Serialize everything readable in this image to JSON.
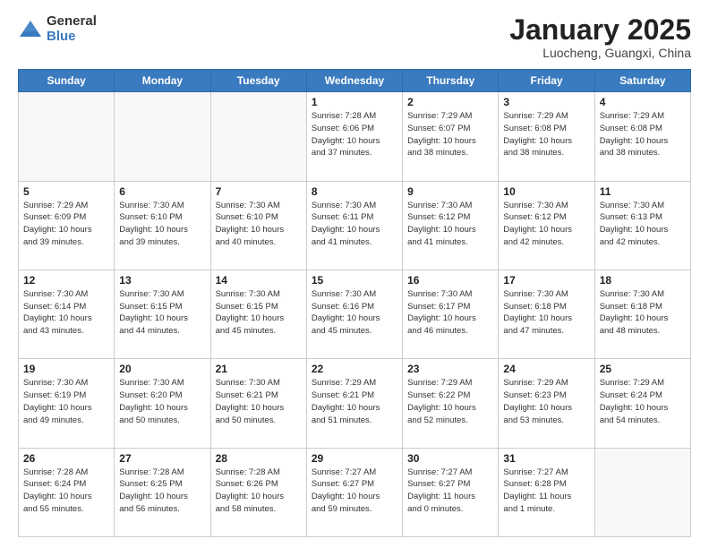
{
  "header": {
    "logo_general": "General",
    "logo_blue": "Blue",
    "month_title": "January 2025",
    "location": "Luocheng, Guangxi, China"
  },
  "days_of_week": [
    "Sunday",
    "Monday",
    "Tuesday",
    "Wednesday",
    "Thursday",
    "Friday",
    "Saturday"
  ],
  "weeks": [
    [
      {
        "day": "",
        "info": ""
      },
      {
        "day": "",
        "info": ""
      },
      {
        "day": "",
        "info": ""
      },
      {
        "day": "1",
        "info": "Sunrise: 7:28 AM\nSunset: 6:06 PM\nDaylight: 10 hours\nand 37 minutes."
      },
      {
        "day": "2",
        "info": "Sunrise: 7:29 AM\nSunset: 6:07 PM\nDaylight: 10 hours\nand 38 minutes."
      },
      {
        "day": "3",
        "info": "Sunrise: 7:29 AM\nSunset: 6:08 PM\nDaylight: 10 hours\nand 38 minutes."
      },
      {
        "day": "4",
        "info": "Sunrise: 7:29 AM\nSunset: 6:08 PM\nDaylight: 10 hours\nand 38 minutes."
      }
    ],
    [
      {
        "day": "5",
        "info": "Sunrise: 7:29 AM\nSunset: 6:09 PM\nDaylight: 10 hours\nand 39 minutes."
      },
      {
        "day": "6",
        "info": "Sunrise: 7:30 AM\nSunset: 6:10 PM\nDaylight: 10 hours\nand 39 minutes."
      },
      {
        "day": "7",
        "info": "Sunrise: 7:30 AM\nSunset: 6:10 PM\nDaylight: 10 hours\nand 40 minutes."
      },
      {
        "day": "8",
        "info": "Sunrise: 7:30 AM\nSunset: 6:11 PM\nDaylight: 10 hours\nand 41 minutes."
      },
      {
        "day": "9",
        "info": "Sunrise: 7:30 AM\nSunset: 6:12 PM\nDaylight: 10 hours\nand 41 minutes."
      },
      {
        "day": "10",
        "info": "Sunrise: 7:30 AM\nSunset: 6:12 PM\nDaylight: 10 hours\nand 42 minutes."
      },
      {
        "day": "11",
        "info": "Sunrise: 7:30 AM\nSunset: 6:13 PM\nDaylight: 10 hours\nand 42 minutes."
      }
    ],
    [
      {
        "day": "12",
        "info": "Sunrise: 7:30 AM\nSunset: 6:14 PM\nDaylight: 10 hours\nand 43 minutes."
      },
      {
        "day": "13",
        "info": "Sunrise: 7:30 AM\nSunset: 6:15 PM\nDaylight: 10 hours\nand 44 minutes."
      },
      {
        "day": "14",
        "info": "Sunrise: 7:30 AM\nSunset: 6:15 PM\nDaylight: 10 hours\nand 45 minutes."
      },
      {
        "day": "15",
        "info": "Sunrise: 7:30 AM\nSunset: 6:16 PM\nDaylight: 10 hours\nand 45 minutes."
      },
      {
        "day": "16",
        "info": "Sunrise: 7:30 AM\nSunset: 6:17 PM\nDaylight: 10 hours\nand 46 minutes."
      },
      {
        "day": "17",
        "info": "Sunrise: 7:30 AM\nSunset: 6:18 PM\nDaylight: 10 hours\nand 47 minutes."
      },
      {
        "day": "18",
        "info": "Sunrise: 7:30 AM\nSunset: 6:18 PM\nDaylight: 10 hours\nand 48 minutes."
      }
    ],
    [
      {
        "day": "19",
        "info": "Sunrise: 7:30 AM\nSunset: 6:19 PM\nDaylight: 10 hours\nand 49 minutes."
      },
      {
        "day": "20",
        "info": "Sunrise: 7:30 AM\nSunset: 6:20 PM\nDaylight: 10 hours\nand 50 minutes."
      },
      {
        "day": "21",
        "info": "Sunrise: 7:30 AM\nSunset: 6:21 PM\nDaylight: 10 hours\nand 50 minutes."
      },
      {
        "day": "22",
        "info": "Sunrise: 7:29 AM\nSunset: 6:21 PM\nDaylight: 10 hours\nand 51 minutes."
      },
      {
        "day": "23",
        "info": "Sunrise: 7:29 AM\nSunset: 6:22 PM\nDaylight: 10 hours\nand 52 minutes."
      },
      {
        "day": "24",
        "info": "Sunrise: 7:29 AM\nSunset: 6:23 PM\nDaylight: 10 hours\nand 53 minutes."
      },
      {
        "day": "25",
        "info": "Sunrise: 7:29 AM\nSunset: 6:24 PM\nDaylight: 10 hours\nand 54 minutes."
      }
    ],
    [
      {
        "day": "26",
        "info": "Sunrise: 7:28 AM\nSunset: 6:24 PM\nDaylight: 10 hours\nand 55 minutes."
      },
      {
        "day": "27",
        "info": "Sunrise: 7:28 AM\nSunset: 6:25 PM\nDaylight: 10 hours\nand 56 minutes."
      },
      {
        "day": "28",
        "info": "Sunrise: 7:28 AM\nSunset: 6:26 PM\nDaylight: 10 hours\nand 58 minutes."
      },
      {
        "day": "29",
        "info": "Sunrise: 7:27 AM\nSunset: 6:27 PM\nDaylight: 10 hours\nand 59 minutes."
      },
      {
        "day": "30",
        "info": "Sunrise: 7:27 AM\nSunset: 6:27 PM\nDaylight: 11 hours\nand 0 minutes."
      },
      {
        "day": "31",
        "info": "Sunrise: 7:27 AM\nSunset: 6:28 PM\nDaylight: 11 hours\nand 1 minute."
      },
      {
        "day": "",
        "info": ""
      }
    ]
  ]
}
